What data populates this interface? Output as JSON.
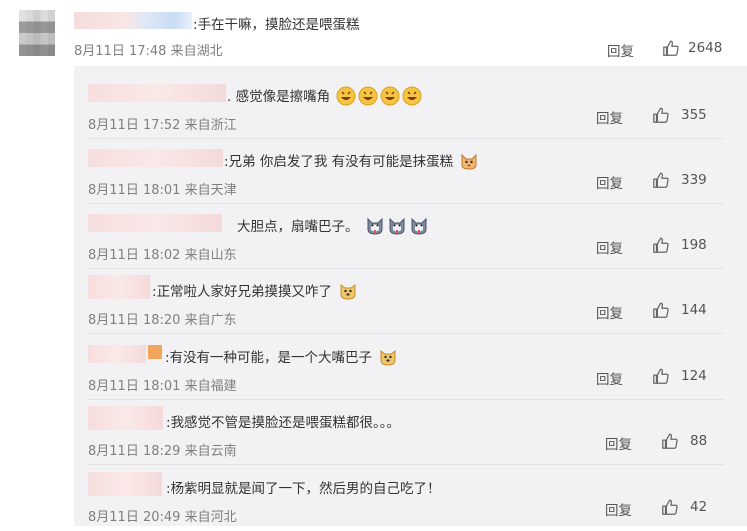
{
  "main_comment": {
    "prefix": ":",
    "text": "手在干嘛，摸脸还是喂蛋糕",
    "date": "8月11日 17:48",
    "location": "来自湖北",
    "reply_label": "回复",
    "likes": "2648"
  },
  "replies": [
    {
      "prefix": ".",
      "text": "感觉像是擦嘴角",
      "date": "8月11日 17:52",
      "location": "来自浙江",
      "reply_label": "回复",
      "likes": "355",
      "emoji_icons": [
        "grinning-sweat-face-icon",
        "grinning-sweat-face-icon",
        "grinning-sweat-face-icon",
        "grinning-sweat-face-icon"
      ]
    },
    {
      "prefix": ":",
      "text": "兄弟 你启发了我 有没有可能是抹蛋糕",
      "date": "8月11日 18:01",
      "location": "来自天津",
      "reply_label": "回复",
      "likes": "339",
      "emoji_icons": [
        "cat-icon"
      ]
    },
    {
      "prefix": "",
      "text": "大胆点，扇嘴巴子。",
      "date": "8月11日 18:02",
      "location": "来自山东",
      "reply_label": "回复",
      "likes": "198",
      "emoji_icons": [
        "husky-dog-icon",
        "husky-dog-icon",
        "husky-dog-icon"
      ]
    },
    {
      "prefix": ":",
      "text": "正常啦人家好兄弟摸摸又咋了",
      "date": "8月11日 18:20",
      "location": "来自广东",
      "reply_label": "回复",
      "likes": "144",
      "emoji_icons": [
        "doge-icon"
      ]
    },
    {
      "prefix": ":",
      "text": "有没有一种可能，是一个大嘴巴子",
      "date": "8月11日 18:01",
      "location": "来自福建",
      "reply_label": "回复",
      "likes": "124",
      "emoji_icons": [
        "doge-icon"
      ]
    },
    {
      "prefix": ":",
      "text": "我感觉不管是摸脸还是喂蛋糕都很。。。",
      "date": "8月11日 18:29",
      "location": "来自云南",
      "reply_label": "回复",
      "likes": "88",
      "emoji_icons": []
    },
    {
      "prefix": ":",
      "text": "杨紫明显就是闻了一下，然后男的自己吃了！",
      "date": "8月11日 20:49",
      "location": "来自河北",
      "reply_label": "回复",
      "likes": "42",
      "emoji_icons": []
    }
  ],
  "colors": {
    "panel_bg": "#f2f2f5",
    "meta_text": "#808080",
    "name_blur": "#f7dede",
    "emoji_yellow": "#f6c443"
  }
}
